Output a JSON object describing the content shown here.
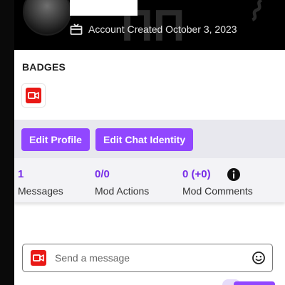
{
  "header": {
    "account_created": "Account Created October 3, 2023"
  },
  "badges": {
    "title": "BADGES",
    "items": [
      {
        "icon": "camera-badge-icon"
      }
    ]
  },
  "actions": {
    "edit_profile": "Edit Profile",
    "edit_chat_identity": "Edit Chat Identity"
  },
  "stats": {
    "messages": {
      "value": "1",
      "label": "Messages"
    },
    "mod_actions": {
      "value": "0/0",
      "label": "Mod Actions"
    },
    "mod_comments": {
      "value": "0 (+0)",
      "label": "Mod Comments"
    }
  },
  "chat": {
    "placeholder": "Send a message"
  },
  "colors": {
    "accent": "#9147ff",
    "stat_value": "#772ce8",
    "badge_red": "#e91916"
  }
}
